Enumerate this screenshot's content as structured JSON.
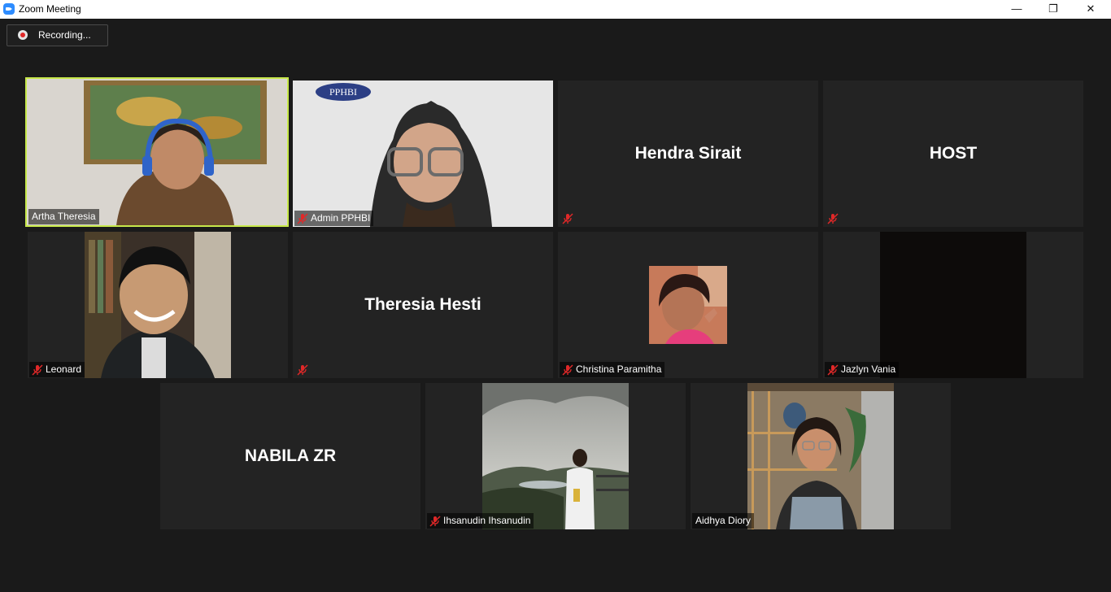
{
  "window": {
    "title": "Zoom Meeting",
    "minimize": "—",
    "restore": "❐",
    "close": "✕"
  },
  "recording": {
    "label": "Recording..."
  },
  "participants": [
    {
      "name": "Artha Theresia"
    },
    {
      "name": "Admin PPHBI",
      "watermark": "PPHBI"
    },
    {
      "name": "Hendra Sirait"
    },
    {
      "name": "HOST"
    },
    {
      "name": "Leonard"
    },
    {
      "name": "Theresia Hesti"
    },
    {
      "name": "Christina Paramitha"
    },
    {
      "name": "Jazlyn Vania"
    },
    {
      "name": "NABILA ZR"
    },
    {
      "name": "Ihsanudin Ihsanudin"
    },
    {
      "name": "Aidhya Diory"
    }
  ]
}
